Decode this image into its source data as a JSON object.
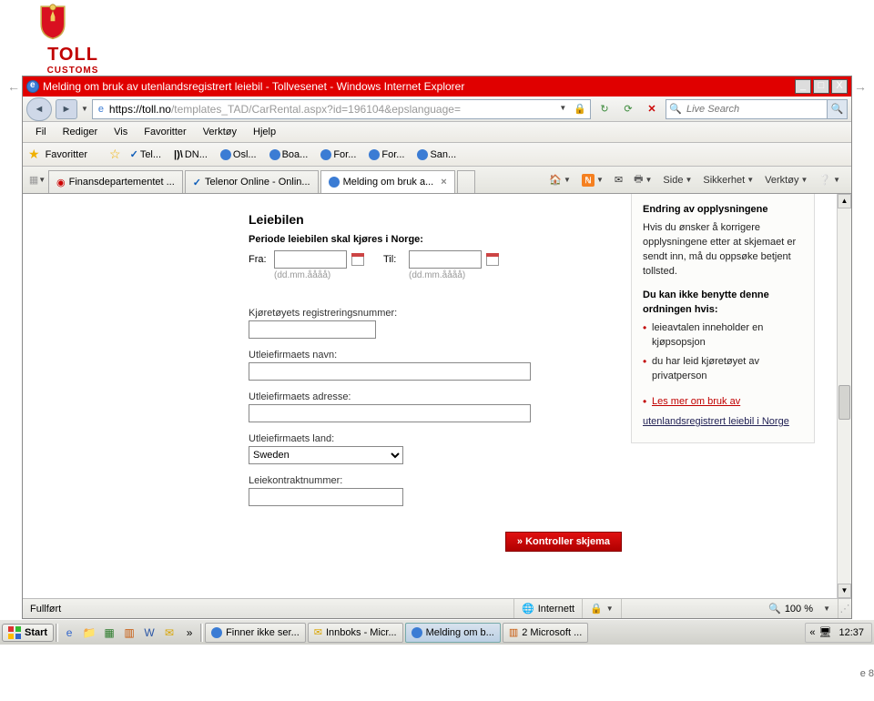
{
  "logo": {
    "brand": "TOLL",
    "sub": "CUSTOMS"
  },
  "window": {
    "title": "Melding om bruk av utenlandsregistrert leiebil - Tollvesenet - Windows Internet Explorer",
    "url_host": "https://toll.no",
    "url_path": "/templates_TAD/CarRental.aspx?id=196104&epslanguage=",
    "search_placeholder": "Live Search"
  },
  "menu": {
    "fil": "Fil",
    "rediger": "Rediger",
    "vis": "Vis",
    "favoritter": "Favoritter",
    "verktoy": "Verktøy",
    "hjelp": "Hjelp"
  },
  "favbar": {
    "label": "Favoritter",
    "items": [
      "Tel...",
      "DN...",
      "Osl...",
      "Boa...",
      "For...",
      "For...",
      "San..."
    ]
  },
  "tabs": {
    "t0": "Finansdepartementet ...",
    "t1": "Telenor Online - Onlin...",
    "t2": "Melding om bruk a...",
    "tools": {
      "side": "Side",
      "sikkerhet": "Sikkerhet",
      "verktoy": "Verktøy"
    }
  },
  "sidebar": {
    "h1": "Endring av opplysningene",
    "p1": "Hvis du ønsker å korrigere opplysningene etter at skjemaet er sendt inn, må du oppsøke betjent tollsted.",
    "h2": "Du kan ikke benytte denne ordningen hvis:",
    "li1": "leieavtalen inneholder en kjøpsopsjon",
    "li2": "du har leid kjøretøyet av privatperson",
    "link_pre": "Les mer om bruk av",
    "link_txt": "utenlandsregistrert leiebil i Norge"
  },
  "form": {
    "heading": "Leiebilen",
    "period": "Periode leiebilen skal kjøres i Norge:",
    "fra": "Fra:",
    "til": "Til:",
    "hint": "(dd.mm.åååå)",
    "regnr": "Kjøretøyets registreringsnummer:",
    "firm_name": "Utleiefirmaets navn:",
    "firm_addr": "Utleiefirmaets adresse:",
    "firm_country": "Utleiefirmaets land:",
    "country_selected": "Sweden",
    "contract": "Leiekontraktnummer:",
    "submit": "» Kontroller skjema"
  },
  "status": {
    "left": "Fullført",
    "zone": "Internett",
    "zoom": "100 %"
  },
  "page_marker": "e 8",
  "taskbar": {
    "start": "Start",
    "more": "»",
    "t0": "Finner ikke ser...",
    "t1": "Innboks - Micr...",
    "t2": "Melding om b...",
    "t3": "2 Microsoft ...",
    "tray_more": "«",
    "clock": "12:37"
  }
}
